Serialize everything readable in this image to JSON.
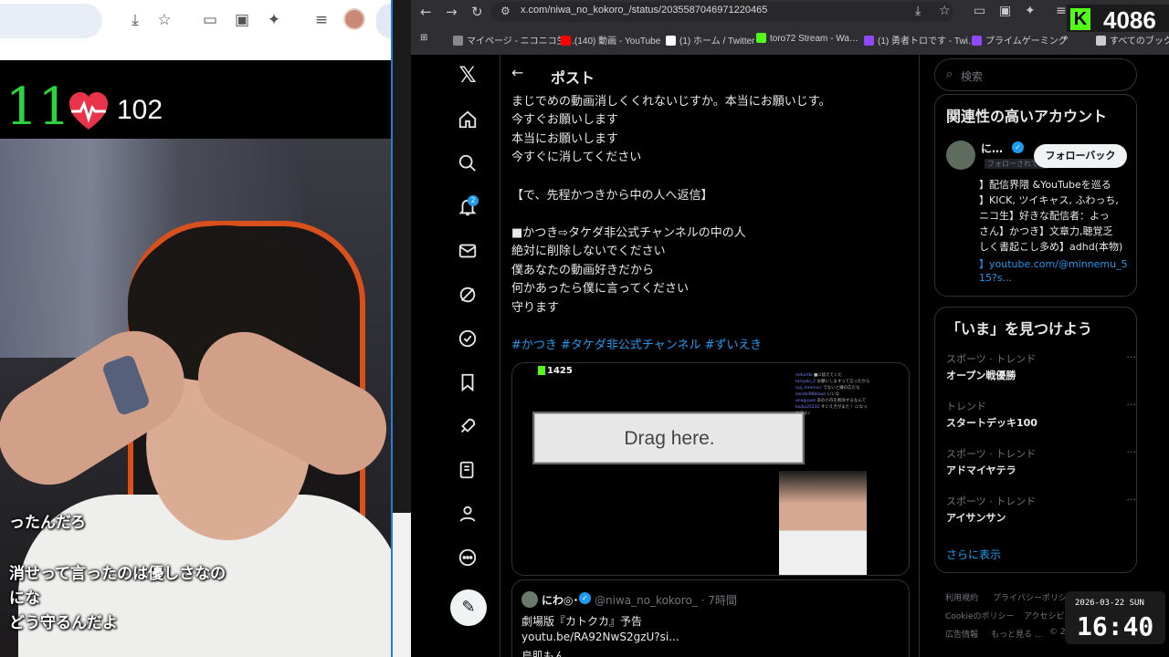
{
  "stream": {
    "counter": "11",
    "bpm": "102",
    "captions": [
      "ったんだろ",
      "消せって言ったのは優しさなの",
      "にな",
      "どう守るんだよ"
    ]
  },
  "browser": {
    "url": "x.com/niwa_no_kokoro_/status/2035587046971220465",
    "bookmarks": [
      {
        "label": "マイページ - ニコニコ生…",
        "color": "#888888"
      },
      {
        "label": "(140) 動画 - YouTube",
        "color": "#ff0000"
      },
      {
        "label": "(1) ホーム / Twitter",
        "color": "#ffffff"
      },
      {
        "label": "toro72 Stream - Wa…",
        "color": "#53fc18"
      },
      {
        "label": "(1) 勇者トロです - Twi…",
        "color": "#9146ff"
      },
      {
        "label": "プライムゲーミング",
        "color": "#9146ff"
      },
      {
        "label": "すべてのブックマー",
        "color": "#cccccc"
      }
    ],
    "kick_count": "4086",
    "kick_letter": "K"
  },
  "x_nav": {
    "notif_count": "2"
  },
  "post": {
    "header_title": "ポスト",
    "lines": [
      "まじでめの動画消しくくれないじすか。本当にお願いじす。",
      "今すぐお願いします",
      "本当にお願いします",
      "今すぐに消してください",
      "",
      "【で、先程かつきから中の人へ返信】",
      "",
      "■かつき⇨タケダ非公式チャンネルの中の人",
      "絶対に削除しないでください",
      "僕あなたの動画好きだから",
      "何かあったら僕に言ってください",
      "守ります"
    ],
    "hashtags": "#かつき #タケダ非公式チャンネル #ずいえき",
    "media": {
      "count": "1425",
      "drag_text": "Drag here.",
      "chat": [
        {
          "user": "mdumbi",
          "msg": "■に抜えてくだ"
        },
        {
          "user": "tairyaki_2",
          "msg": "お願いしますって言ったから"
        },
        {
          "user": "ryo_mmmics",
          "msg": "でないと嫌の広だな"
        },
        {
          "user": "sandai96blows",
          "msg": "いいな"
        },
        {
          "user": "anaguaaz",
          "msg": "あの小舟を削除するなんて"
        },
        {
          "user": "koiba25232",
          "msg": "すいえきがまた ！になっ"
        },
        {
          "user": "",
          "msg": "ヤろよ♪"
        }
      ]
    },
    "quote": {
      "name": "にわ◎･",
      "handle": "@niwa_no_kokoro_ · 7時間",
      "line1": "劇場版『カトクカ』予告",
      "line2": "youtu.be/RA92NwS2gzU?si...",
      "line3": "鳥肌もん"
    }
  },
  "sidebar": {
    "search_placeholder": "検索",
    "related_title": "関連性の高いアカウント",
    "account_name": "に…",
    "follows_you": "フォローされてい",
    "follow_back": "フォローバック",
    "bio": [
      "】配信界隈 &YouTubeを巡る",
      "】KICK, ツイキャス, ふわっち,",
      "ニコ生】好きな配信者：よっ",
      "さん】かつき】文章力,聴覚乏",
      "しく書起こし多め】adhd(本物)",
      "】youtube.com/@minnemu_5",
      "15?s..."
    ],
    "now_title": "「いま」を見つけよう",
    "trends": [
      {
        "category": "スポーツ · トレンド",
        "name": "オープン戦優勝"
      },
      {
        "category": "トレンド",
        "name": "スタートデッキ100"
      },
      {
        "category": "スポーツ · トレンド",
        "name": "アドマイヤテラ"
      },
      {
        "category": "スポーツ · トレンド",
        "name": "アイサンサン"
      }
    ],
    "show_more": "さらに表示",
    "footer": [
      "利用規約",
      "プライバシーポリシ",
      "Cookieのポリシー",
      "アクセシビ",
      "広告情報",
      "もっと見る …",
      "© 2"
    ]
  },
  "clock": {
    "date": "2026-03-22 SUN",
    "time": "16:40"
  },
  "colors": {
    "kick_green": "#53fc18",
    "x_blue": "#1d9bf0",
    "heart_red": "#e8334a"
  }
}
